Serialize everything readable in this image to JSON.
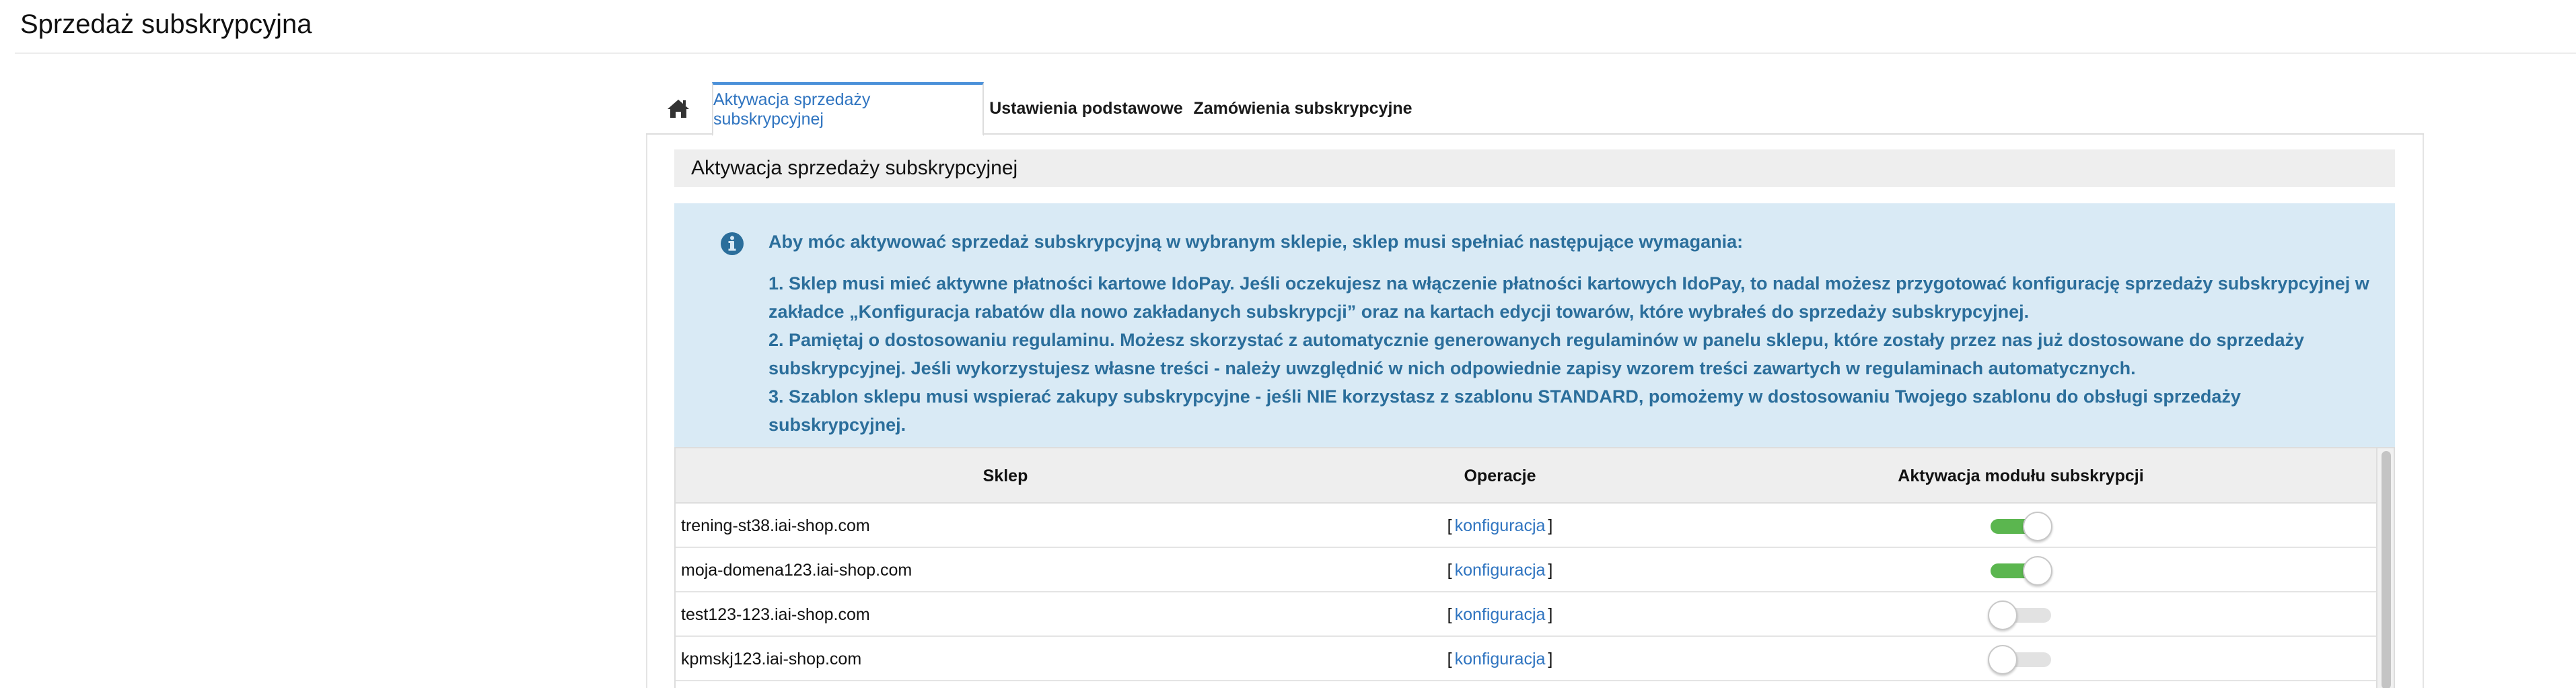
{
  "page": {
    "title": "Sprzedaż subskrypcyjna"
  },
  "tabs": {
    "home_icon": "home-icon",
    "items": [
      {
        "label": "Aktywacja sprzedaży subskrypcyjnej",
        "active": true
      },
      {
        "label": "Ustawienia podstawowe",
        "active": false
      },
      {
        "label": "Zamówienia subskrypcyjne",
        "active": false
      }
    ]
  },
  "section": {
    "title": "Aktywacja sprzedaży subskrypcyjnej"
  },
  "info": {
    "icon": "info-circle-icon",
    "intro": "Aby móc aktywować sprzedaż subskrypcyjną w wybranym sklepie, sklep musi spełniać następujące wymagania:",
    "items": [
      "1. Sklep musi mieć aktywne płatności kartowe IdoPay. Jeśli oczekujesz na włączenie płatności kartowych IdoPay, to nadal możesz przygotować konfigurację sprzedaży subskrypcyjnej w zakładce „Konfiguracja rabatów dla nowo zakładanych subskrypcji” oraz na kartach edycji towarów, które wybrałeś do sprzedaży subskrypcyjnej.",
      "2. Pamiętaj o dostosowaniu regulaminu. Możesz skorzystać z automatycznie generowanych regulaminów w panelu sklepu, które zostały przez nas już dostosowane do sprzedaży subskrypcyjnej. Jeśli wykorzystujesz własne treści - należy uwzględnić w nich odpowiednie zapisy wzorem treści zawartych w regulaminach automatycznych.",
      "3. Szablon sklepu musi wspierać zakupy subskrypcyjne - jeśli NIE korzystasz z szablonu STANDARD, pomożemy w dostosowaniu Twojego szablonu do obsługi sprzedaży subskrypcyjnej."
    ],
    "colors": {
      "background": "#d9eaf5",
      "text": "#2b6e9b"
    }
  },
  "table": {
    "headers": {
      "shop": "Sklep",
      "operations": "Operacje",
      "activation": "Aktywacja modułu subskrypcji"
    },
    "bracket_open": "[",
    "bracket_close": "]",
    "rows": [
      {
        "shop": "trening-st38.iai-shop.com",
        "link": "konfiguracja",
        "enabled": true
      },
      {
        "shop": "moja-domena123.iai-shop.com",
        "link": "konfiguracja",
        "enabled": true
      },
      {
        "shop": "test123-123.iai-shop.com",
        "link": "konfiguracja",
        "enabled": false
      },
      {
        "shop": "kpmskj123.iai-shop.com",
        "link": "konfiguracja",
        "enabled": false
      }
    ]
  },
  "colors": {
    "accent": "#2f74c0",
    "toggle_on": "#5bb64f",
    "toggle_off": "#e2e2e2"
  }
}
